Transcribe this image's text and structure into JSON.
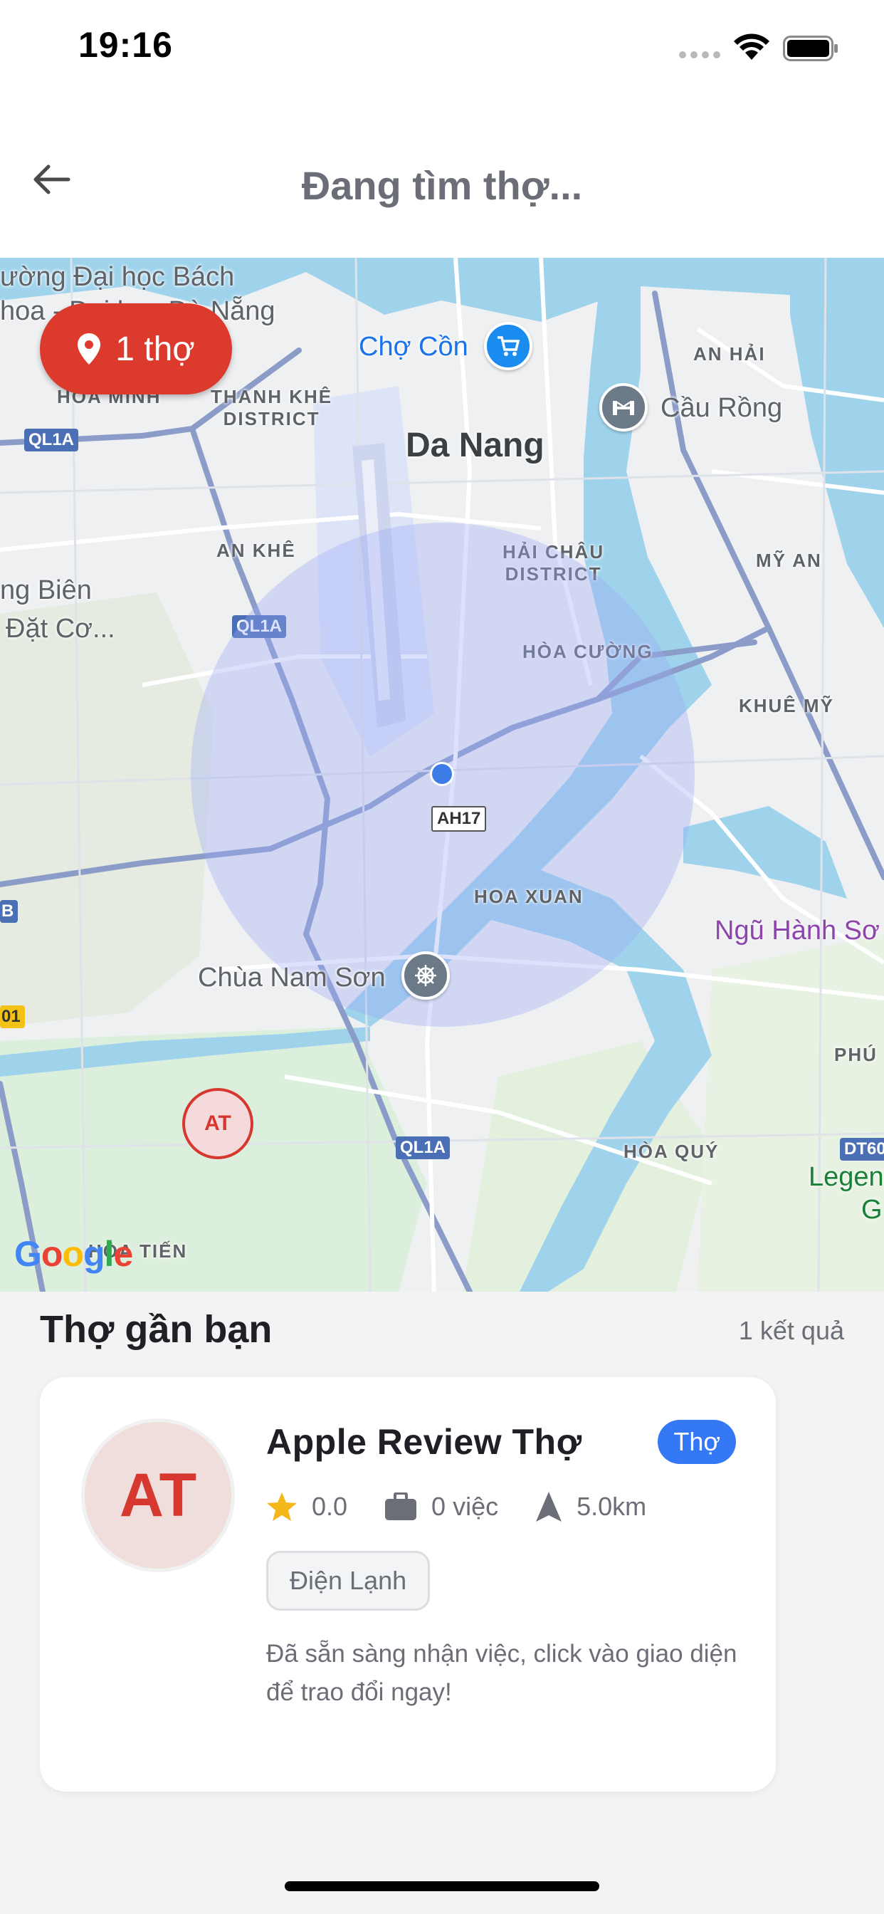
{
  "status_bar": {
    "time": "19:16"
  },
  "header": {
    "title": "Đang tìm thợ..."
  },
  "map": {
    "count_pill": {
      "label": "1 thợ",
      "icon": "location-pin-icon"
    },
    "labels": {
      "university": "ường Đại học Bách",
      "university2": "hoa - Đại học Đà Nẵng",
      "cho_con": "Chợ Cồn",
      "an_hai": "AN HẢI",
      "cau_rong": "Cầu Rồng",
      "hoa_minh": "HÒA MINH",
      "thanh_khe": "THANH KHÊ\nDISTRICT",
      "da_nang": "Da Nang",
      "an_khe": "AN KHÊ",
      "hai_chau": "HẢI CHÂU\nDISTRICT",
      "my_an": "MỸ AN",
      "bien": "ng Biên",
      "dat_co": "Đặt Cơ...",
      "hoa_cuong": "HÒA CƯỜNG",
      "khue_my": "KHUÊ MỸ",
      "hoa_xuan": "HOA XUAN",
      "ngu_hanh_son": "Ngũ Hành Sơ",
      "chua_nam_son": "Chùa Nam Sơn",
      "phu": "PHÚ",
      "hoa_quy": "HÒA QUÝ",
      "legend": "Legen",
      "legend2": "G",
      "hoa_tien": "HÒA TIẾN"
    },
    "shields": {
      "ql1a_1": "QL1A",
      "ql1a_2": "QL1A",
      "ql1a_3": "QL1A",
      "ah17": "AH17",
      "b": "B",
      "n01": "01",
      "dt60": "DT60"
    },
    "worker_marker": "AT",
    "google_logo": "Google"
  },
  "list": {
    "heading": "Thợ gần bạn",
    "result_count": "1 kết quả"
  },
  "worker_card": {
    "avatar_initials": "AT",
    "name": "Apple Review Thợ",
    "role_badge": "Thợ",
    "rating": "0.0",
    "jobs": "0 việc",
    "distance": "5.0km",
    "skill": "Điện Lạnh",
    "description": "Đã sẵn sàng nhận việc, click vào giao diện để trao đổi ngay!"
  },
  "colors": {
    "accent_red": "#dd3a2e",
    "badge_blue": "#3478f6",
    "star": "#f5b81c",
    "user_dot": "#3d7be6"
  }
}
